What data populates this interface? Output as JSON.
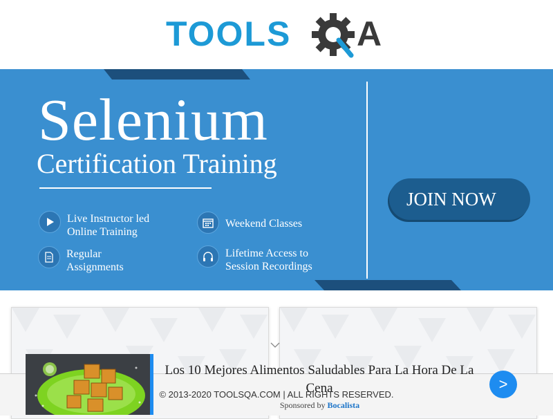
{
  "header": {
    "logo_text_left": "TOOLS",
    "logo_text_right": "A"
  },
  "banner": {
    "title": "Selenium",
    "subtitle": "Certification Training",
    "features": [
      {
        "line1": "Live Instructor led",
        "line2": "Online Training",
        "icon": "play-icon"
      },
      {
        "line1": "Weekend Classes",
        "line2": "",
        "icon": "calendar-icon"
      },
      {
        "line1": "Regular",
        "line2": "Assignments",
        "icon": "document-icon"
      },
      {
        "line1": "Lifetime Access to",
        "line2": "Session Recordings",
        "icon": "headphones-icon"
      }
    ],
    "join_label": "JOIN NOW"
  },
  "ad": {
    "headline": "Los 10 Mejores Alimentos Saludables Para La Hora De La Cena",
    "sponsored_prefix": "Sponsored by",
    "sponsor_name": "Bocalista",
    "next_label": ">"
  },
  "footer": {
    "copyright": "© 2013-2020 TOOLSQA.COM | ALL RIGHTS RESERVED."
  },
  "colors": {
    "brand_blue": "#1d9ad6",
    "banner_blue": "#3a8fd0",
    "dark_navy": "#1c4f7c",
    "next_button": "#1e8cf0"
  }
}
